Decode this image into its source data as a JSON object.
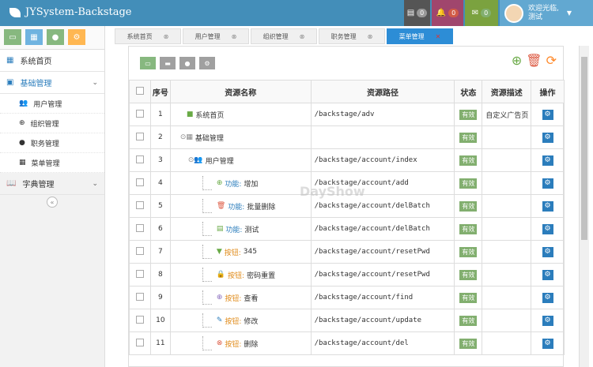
{
  "app": {
    "title": "JYSystem-Backstage"
  },
  "topbar": {
    "badges": [
      {
        "icon": "list-icon",
        "count": "0",
        "color": "#555"
      },
      {
        "icon": "bell-icon",
        "count": "0",
        "color": "#a0466d"
      },
      {
        "icon": "mail-icon",
        "count": "0",
        "color": "#7ba23f"
      }
    ],
    "user": {
      "greeting": "欢迎光临,",
      "name": "测试"
    }
  },
  "sidebar": {
    "shortcuts": [
      {
        "icon": "monitor-icon",
        "color": "#87b87f"
      },
      {
        "icon": "grid-icon",
        "color": "#6fb3e0"
      },
      {
        "icon": "user-icon",
        "color": "#87b87f"
      },
      {
        "icon": "cog-icon",
        "color": "#ffb752"
      }
    ],
    "items": [
      {
        "label": "系统首页"
      },
      {
        "label": "基础管理"
      }
    ],
    "subitems": [
      {
        "label": "用户管理"
      },
      {
        "label": "组织管理"
      },
      {
        "label": "职务管理"
      },
      {
        "label": "菜单管理"
      }
    ],
    "dict": {
      "label": "字典管理"
    }
  },
  "tabs": [
    {
      "label": "系统首页"
    },
    {
      "label": "用户管理"
    },
    {
      "label": "组织管理"
    },
    {
      "label": "职务管理"
    },
    {
      "label": "菜单管理"
    }
  ],
  "table": {
    "headers": [
      "序号",
      "资源名称",
      "资源路径",
      "状态",
      "资源描述",
      "操作"
    ],
    "rows": [
      {
        "no": "1",
        "name": "系统首页",
        "path": "/backstage/adv",
        "status": "有效",
        "desc": "自定义广告页"
      },
      {
        "no": "2",
        "name": "基础管理",
        "path": "",
        "status": "有效",
        "desc": ""
      },
      {
        "no": "3",
        "name": "用户管理",
        "path": "/backstage/account/index",
        "status": "有效",
        "desc": ""
      },
      {
        "no": "4",
        "prefix": "功能:",
        "name": "增加",
        "path": "/backstage/account/add",
        "status": "有效",
        "desc": ""
      },
      {
        "no": "5",
        "prefix": "功能:",
        "name": "批量删除",
        "path": "/backstage/account/delBatch",
        "status": "有效",
        "desc": ""
      },
      {
        "no": "6",
        "prefix": "功能:",
        "name": "测试",
        "path": "/backstage/account/delBatch",
        "status": "有效",
        "desc": ""
      },
      {
        "no": "7",
        "prefix": "按钮:",
        "name": "345",
        "path": "/backstage/account/resetPwd",
        "status": "有效",
        "desc": ""
      },
      {
        "no": "8",
        "prefix": "按钮:",
        "name": "密码重置",
        "path": "/backstage/account/resetPwd",
        "status": "有效",
        "desc": ""
      },
      {
        "no": "9",
        "prefix": "按钮:",
        "name": "查看",
        "path": "/backstage/account/find",
        "status": "有效",
        "desc": ""
      },
      {
        "no": "10",
        "prefix": "按钮:",
        "name": "修改",
        "path": "/backstage/account/update",
        "status": "有效",
        "desc": ""
      },
      {
        "no": "11",
        "prefix": "按钮:",
        "name": "删除",
        "path": "/backstage/account/del",
        "status": "有效",
        "desc": ""
      }
    ]
  },
  "watermark": "DayShow"
}
